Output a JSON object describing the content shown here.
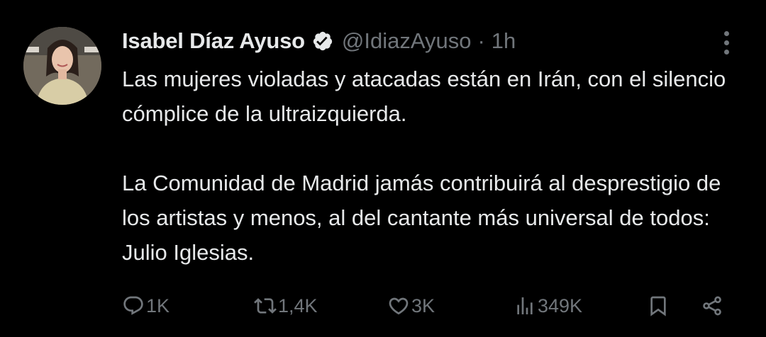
{
  "tweet": {
    "author_name": "Isabel Díaz Ayuso",
    "handle": "@IdiazAyuso",
    "separator": "·",
    "time": "1h",
    "paragraphs": [
      "Las mujeres violadas y atacadas están en Irán, con el silencio cómplice de la ultraizquierda.",
      "La Comunidad de Madrid jamás contribuirá al desprestigio de los artistas y menos, al del cantante más universal de todos: Julio Iglesias."
    ],
    "verified": true
  },
  "actions": {
    "reply_count": "1K",
    "retweet_count": "1,4K",
    "like_count": "3K",
    "views_count": "349K"
  },
  "icons": {
    "verified": "verified-badge-icon",
    "more": "more-options-icon",
    "reply": "reply-icon",
    "retweet": "retweet-icon",
    "like": "heart-icon",
    "views": "views-chart-icon",
    "bookmark": "bookmark-icon",
    "share": "share-icon"
  },
  "colors": {
    "background": "#000000",
    "text": "#e7e9ea",
    "muted": "#71767b"
  }
}
